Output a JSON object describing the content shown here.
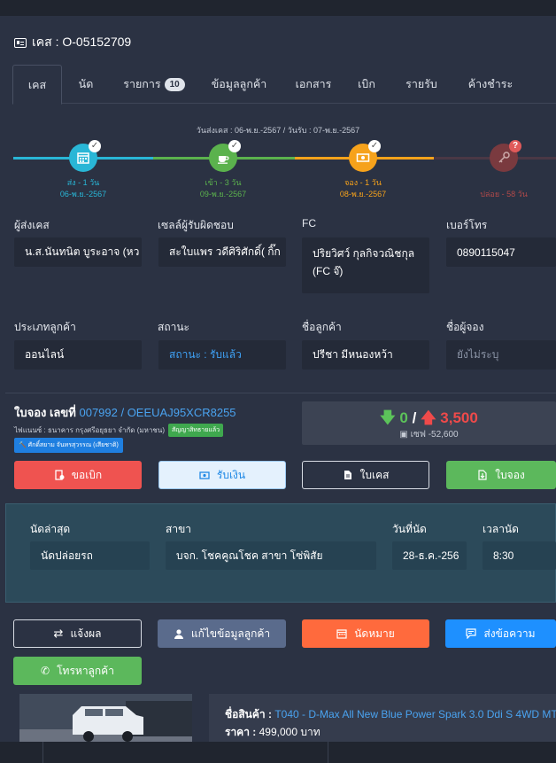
{
  "case": {
    "title": "เคส : O-05152709"
  },
  "tabs": [
    {
      "label": "เคส"
    },
    {
      "label": "นัด"
    },
    {
      "label": "รายการ",
      "badge": "10"
    },
    {
      "label": "ข้อมูลลูกค้า"
    },
    {
      "label": "เอกสาร"
    },
    {
      "label": "เบิก"
    },
    {
      "label": "รายรับ"
    },
    {
      "label": "ค้างชำระ"
    }
  ],
  "timeline": {
    "header": "วันส่งเคส : 06-พ.ย.-2567 / วันรับ : 07-พ.ย.-2567",
    "steps": [
      {
        "label": "ส่ง - 1 วัน",
        "date": "06-พ.ย.-2567",
        "color": "#29b6d6"
      },
      {
        "label": "เข้า - 3 วัน",
        "date": "09-พ.ย.-2567",
        "color": "#5bb24d"
      },
      {
        "label": "จอง - 1 วัน",
        "date": "08-พ.ย.-2567",
        "color": "#f6a21b"
      },
      {
        "label": "ปล่อย - 58 วัน",
        "date": "",
        "color": "#b24a4a"
      }
    ]
  },
  "fields": {
    "sender_label": "ผู้ส่งเคส",
    "sender_value": "น.ส.นันทนิต บูระอาจ (หว",
    "sales_label": "เซลล์ผู้รับผิดชอบ",
    "sales_value": "สะใบแพร วดีศิริศักดิ์( กิ๊ก",
    "fc_label": "FC",
    "fc_value": "ปริยวิศว์ กุลกิจวณิชกุล (FC จ๊)",
    "phone_label": "เบอร์โทร",
    "phone_value": "0890115047",
    "ctype_label": "ประเภทลูกค้า",
    "ctype_value": "ออนไลน์",
    "status_label": "สถานะ",
    "status_value": "สถานะ : รับแล้ว",
    "cname_label": "ชื่อลูกค้า",
    "cname_value": "ปรีชา มีหนองหว้า",
    "booker_label": "ชื่อผู้จอง",
    "booker_value": "ยังไม่ระบุ"
  },
  "booking": {
    "title_prefix": "ใบจอง เลขที่",
    "number": "007992 / OEEUAJ95XCR8255",
    "finance": "ไฟแนนซ์ : ธนาคาร กรุงศรีอยุธยา จำกัด (มหาชน)",
    "finance_tag": "สัญญาสิทธายแล้ว",
    "dealer_tag": "ศักดิ์สยาม จันทรสุวรรณ (เสียชาติ)",
    "amount_paid": "0",
    "amount_due": "3,500",
    "slash": "/",
    "advance": "เซฟ -52,600"
  },
  "buttons": {
    "withdraw": "ขอเบิก",
    "receive": "รับเงิน",
    "case_doc": "ใบเคส",
    "booking_doc": "ใบจอง"
  },
  "appointment": {
    "latest_label": "นัดล่าสุด",
    "latest_value": "นัดปล่อยรถ",
    "branch_label": "สาขา",
    "branch_value": "บจก. โชคคูณโชค สาขา โซ่พิสัย",
    "date_label": "วันที่นัด",
    "date_value": "28-ธ.ค.-256",
    "time_label": "เวลานัด",
    "time_value": "8:30"
  },
  "actions": {
    "report": "แจ้งผล",
    "edit_customer": "แก้ไขข้อมูลลูกค้า",
    "appoint": "นัดหมาย",
    "message": "ส่งข้อความ",
    "call": "โทรหาลูกค้า"
  },
  "product": {
    "name_label": "ชื่อสินค้า :",
    "name_value": "T040 - D-Max All New Blue Power Spark 3.0 Ddi S 4WD MT",
    "price_label": "ราคา :",
    "price_value": "499,000 บาท"
  },
  "colors": {
    "red": "#ef5350",
    "green": "#5cb85c",
    "blue": "#1e90ff",
    "orange": "#ff6a3d",
    "slate": "#5a6b8c"
  }
}
